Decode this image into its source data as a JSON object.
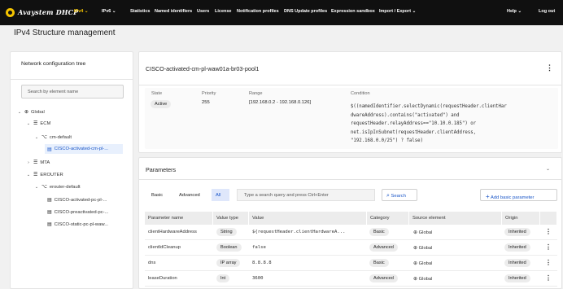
{
  "app": {
    "brand": "Avaystem DHCP",
    "nav": [
      {
        "label": "IPv4 ⌄"
      },
      {
        "label": "IPv6 ⌄"
      },
      {
        "label": "Statistics"
      },
      {
        "label": "Named identifiers"
      },
      {
        "label": "Users"
      },
      {
        "label": "License"
      },
      {
        "label": "Notification profiles"
      },
      {
        "label": "DNS Update profiles"
      },
      {
        "label": "Expression sandbox"
      },
      {
        "label": "Import / Export ⌄"
      }
    ],
    "help": "Help ⌄",
    "logout": "Log out",
    "accent": "#f5c400"
  },
  "page_title": "IPv4 Structure management",
  "tree": {
    "title": "Network configuration tree",
    "search_placeholder": "Search by element name",
    "items": [
      {
        "label": "Global",
        "icon": "globe-icon"
      },
      {
        "label": "ECM",
        "icon": "list-icon"
      },
      {
        "label": "cm-default",
        "icon": "network-icon"
      },
      {
        "label": "CISCO-activated-cm-pl-...",
        "icon": "pool-icon",
        "selected": true
      },
      {
        "label": "MTA",
        "icon": "list-icon"
      },
      {
        "label": "EROUTER",
        "icon": "list-icon"
      },
      {
        "label": "erouter-default",
        "icon": "network-icon"
      },
      {
        "label": "CISCO-activated-pc-pl-...",
        "icon": "pool-icon"
      },
      {
        "label": "CISCO-preactivated-pc-...",
        "icon": "pool-icon"
      },
      {
        "label": "CISCO-static-pc-pl-waw...",
        "icon": "pool-icon"
      }
    ]
  },
  "detail": {
    "title": "CISCO-activated-cm-pl-waw01a-br03-pool1",
    "state_label": "State",
    "state_value": "Active",
    "priority_label": "Priority",
    "priority_value": "255",
    "range_label": "Range",
    "range_value": "[192.168.0.2 - 192.168.0.126]",
    "condition_label": "Condition",
    "condition_lines": [
      "$((namedIdentifier.selectDynamic(requestHeader.clientHar",
      "dwareAddress).contains(\"activated\") and",
      "requestHeader.relayAddress==\"10.10.0.185\") or",
      "net.isIpInSubnet(requestHeader.clientAddress,",
      "\"192.168.0.0/25\") ? false)"
    ]
  },
  "parameters": {
    "title": "Parameters",
    "filters": [
      {
        "label": "Basic"
      },
      {
        "label": "Advanced"
      },
      {
        "label": "All",
        "active": true
      }
    ],
    "search_placeholder": "Type a search query and press Ctrl+Enter",
    "search_button": "Search",
    "add_button": "Add basic parameter",
    "columns": [
      "Parameter name",
      "Value type",
      "Value",
      "Category",
      "Source element",
      "Origin"
    ],
    "rows": [
      {
        "name": "clientHardwareAddress",
        "type": "String",
        "value": "${requestHeader.clientHardwareA...",
        "category": "Basic",
        "source": "Global",
        "origin": "Inherited"
      },
      {
        "name": "clientIdCleanup",
        "type": "Boolean",
        "value": "false",
        "category": "Advanced",
        "source": "Global",
        "origin": "Inherited"
      },
      {
        "name": "dns",
        "type": "IP array",
        "value": "8.8.8.8",
        "category": "Basic",
        "source": "Global",
        "origin": "Inherited"
      },
      {
        "name": "leaseDuration",
        "type": "Int",
        "value": "3600",
        "category": "Advanced",
        "source": "Global",
        "origin": "Inherited"
      }
    ]
  }
}
